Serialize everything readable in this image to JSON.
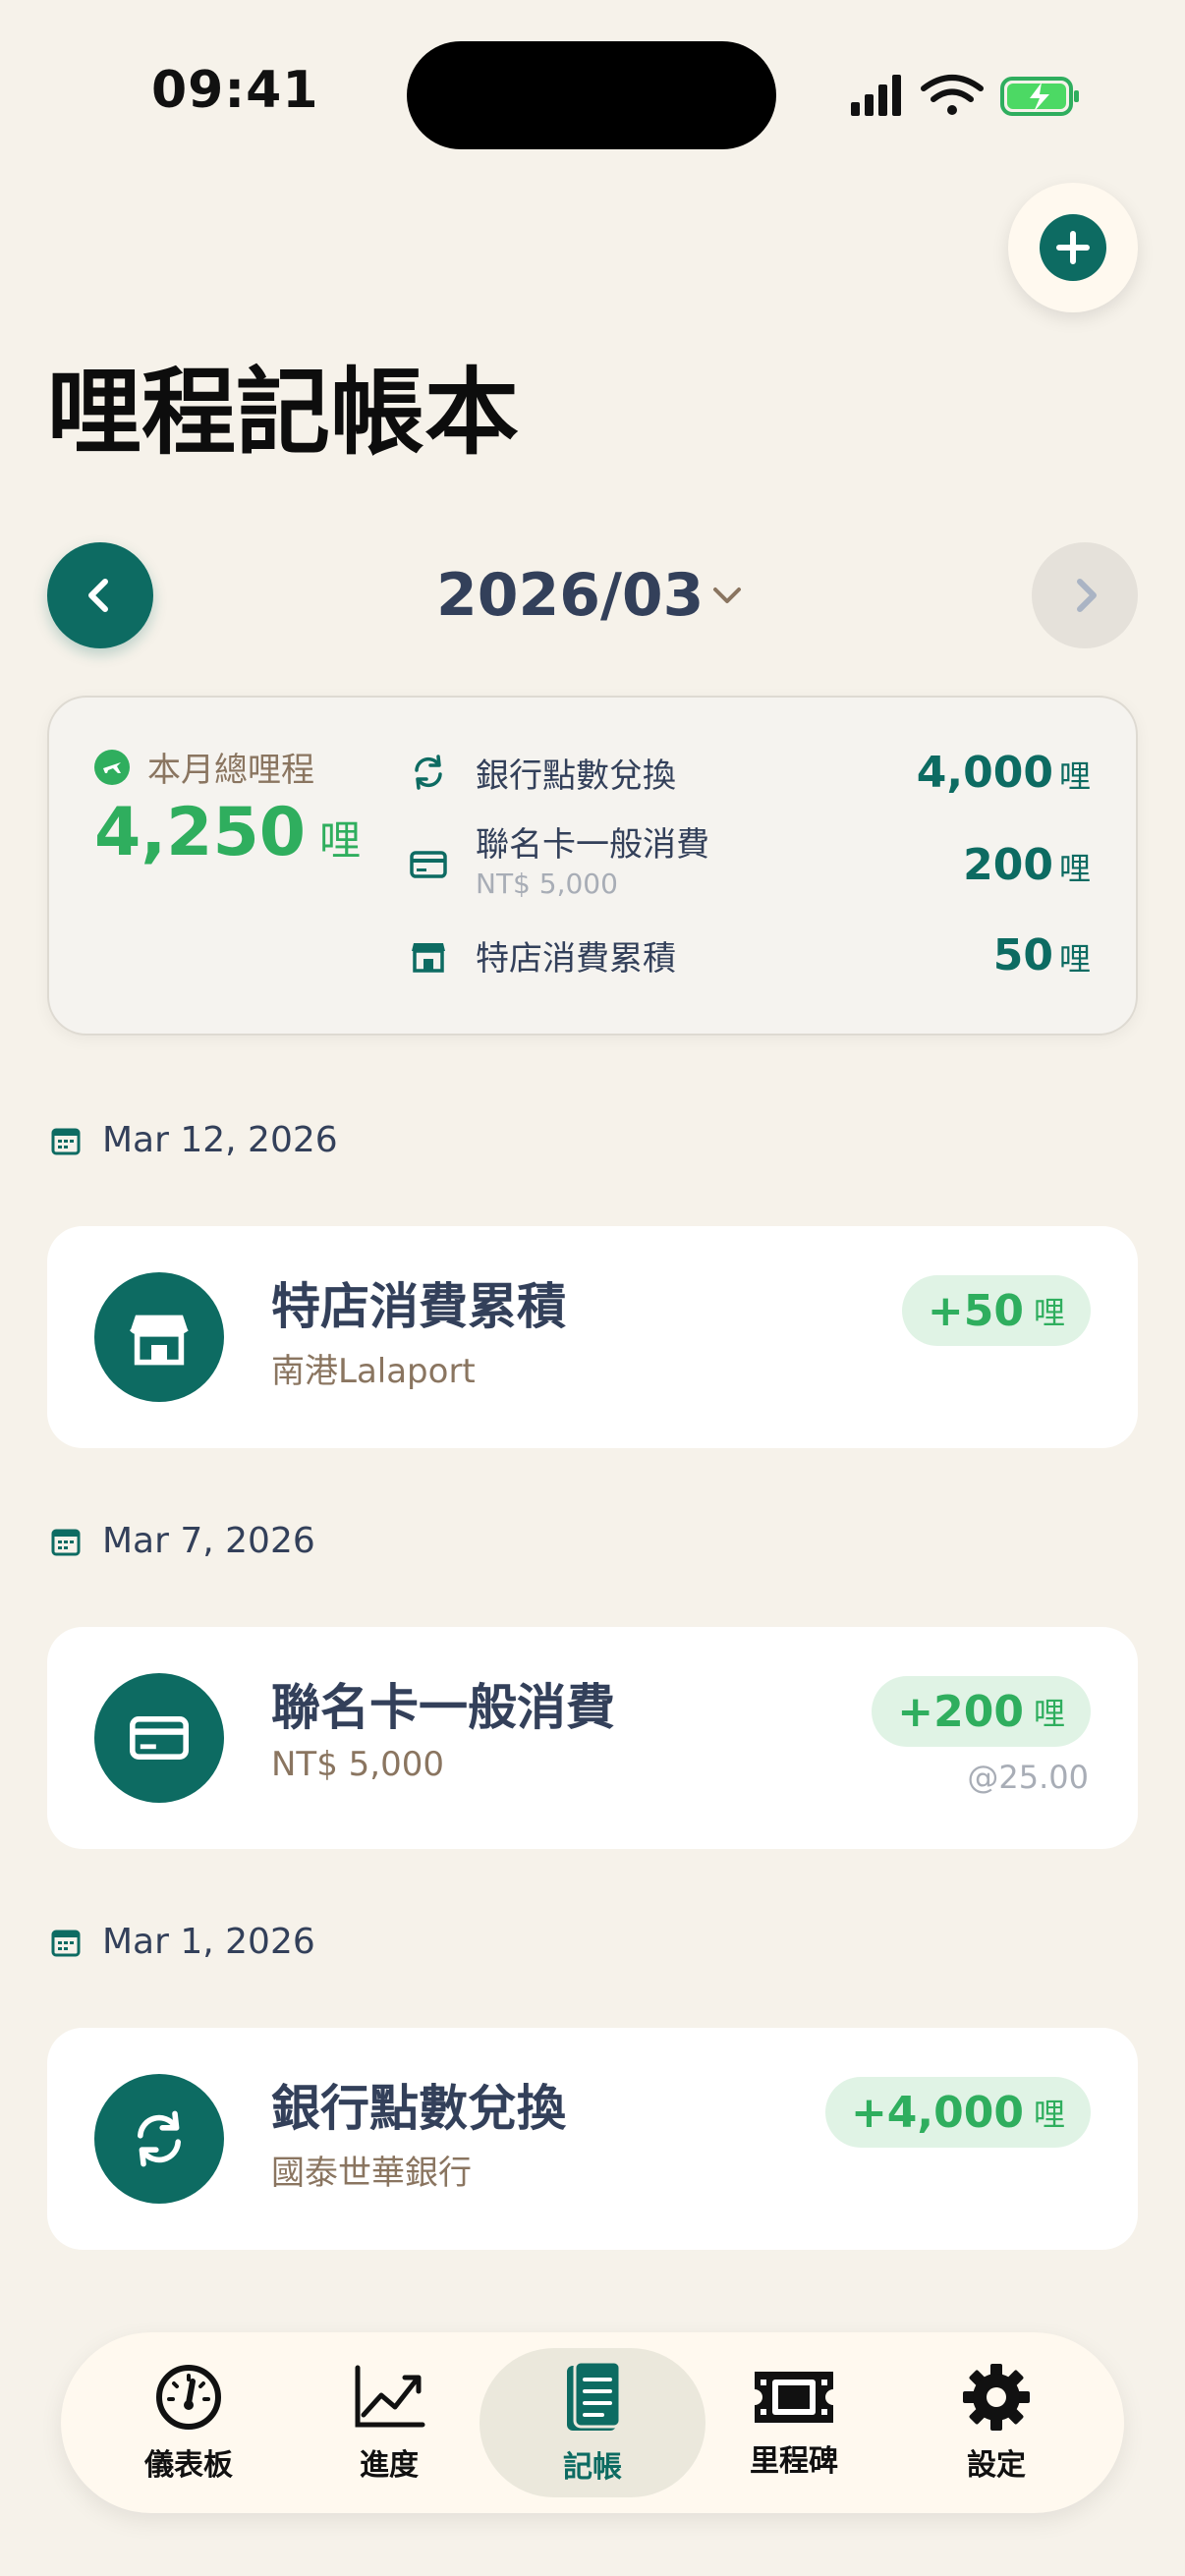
{
  "status_bar": {
    "time": "09:41"
  },
  "header": {
    "title": "哩程記帳本"
  },
  "month_nav": {
    "label": "2026/03"
  },
  "summary": {
    "label": "本月總哩程",
    "total": "4,250",
    "unit": "哩",
    "rows": [
      {
        "label": "銀行點數兌換",
        "sub": "",
        "value": "4,000",
        "unit": "哩",
        "icon": "refresh-icon"
      },
      {
        "label": "聯名卡一般消費",
        "sub": "NT$ 5,000",
        "value": "200",
        "unit": "哩",
        "icon": "credit-card-icon"
      },
      {
        "label": "特店消費累積",
        "sub": "",
        "value": "50",
        "unit": "哩",
        "icon": "store-icon"
      }
    ]
  },
  "groups": [
    {
      "date": "Mar 12, 2026",
      "tx": {
        "title": "特店消費累積",
        "sub": "南港Lalaport",
        "amount": "+50",
        "unit": "哩",
        "rate": "",
        "icon": "store-icon"
      }
    },
    {
      "date": "Mar 7, 2026",
      "tx": {
        "title": "聯名卡一般消費",
        "sub": "NT$ 5,000",
        "amount": "+200",
        "unit": "哩",
        "rate": "@25.00",
        "icon": "credit-card-icon"
      }
    },
    {
      "date": "Mar 1, 2026",
      "tx": {
        "title": "銀行點數兌換",
        "sub": "國泰世華銀行",
        "amount": "+4,000",
        "unit": "哩",
        "rate": "",
        "icon": "refresh-icon"
      }
    }
  ],
  "tabs": [
    {
      "label": "儀表板",
      "icon": "gauge-icon",
      "active": false
    },
    {
      "label": "進度",
      "icon": "chart-up-icon",
      "active": false
    },
    {
      "label": "記帳",
      "icon": "notebook-icon",
      "active": true
    },
    {
      "label": "里程碑",
      "icon": "ticket-icon",
      "active": false
    },
    {
      "label": "設定",
      "icon": "gear-icon",
      "active": false
    }
  ],
  "colors": {
    "accent": "#0d6b62",
    "positive": "#2fae5e",
    "background": "#f6f2ea"
  }
}
